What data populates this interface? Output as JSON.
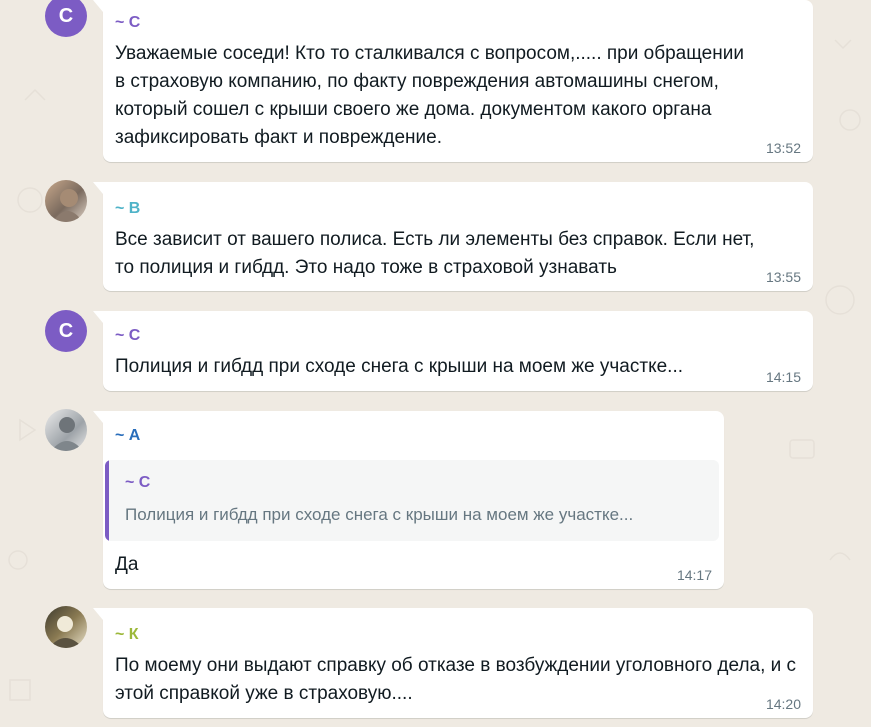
{
  "colors": {
    "background": "#efeae2",
    "bubble": "#ffffff",
    "sender_purple": "#7c5cc4",
    "sender_teal": "#4fb3c8",
    "sender_blue": "#2a6ebb",
    "sender_olive": "#9cb83a",
    "timestamp": "#667781"
  },
  "messages": [
    {
      "avatar_letter": "С",
      "sender": "~ С",
      "text": "Уважаемые соседи! Кто то сталкивался с вопросом,..... при обращении в  страховую компанию, по факту повреждения автомашины снегом, который сошел с крыши своего же дома. документом какого органа зафиксировать факт и повреждение.",
      "time": "13:52"
    },
    {
      "avatar_letter": "",
      "sender": "~ В",
      "text": "Все зависит от вашего полиса. Есть ли элементы без справок. Если нет, то полиция и гибдд. Это надо тоже в страховой узнавать",
      "time": "13:55"
    },
    {
      "avatar_letter": "С",
      "sender": "~ С",
      "text": "Полиция и гибдд при сходе снега с крыши на моем же участке...",
      "time": "14:15"
    },
    {
      "avatar_letter": "",
      "sender": "~ А",
      "quote": {
        "sender": "~ С",
        "text": "Полиция и гибдд при сходе снега с крыши на моем же участке..."
      },
      "text": "Да",
      "time": "14:17"
    },
    {
      "avatar_letter": "",
      "sender": "~ К",
      "text": "По моему они выдают справку об отказе в возбуждении уголовного дела, и с этой справкой уже в страховую....",
      "time": "14:20"
    }
  ]
}
